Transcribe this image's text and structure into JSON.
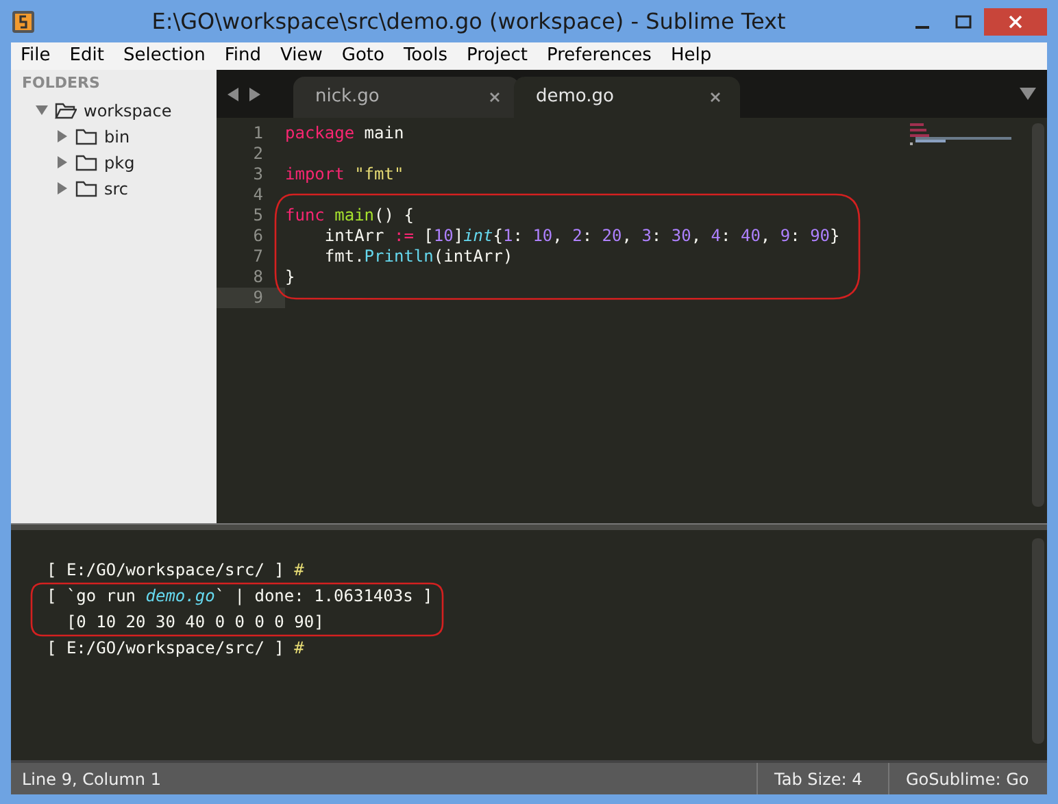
{
  "window": {
    "title": "E:\\GO\\workspace\\src\\demo.go (workspace) - Sublime Text"
  },
  "menu": [
    "File",
    "Edit",
    "Selection",
    "Find",
    "View",
    "Goto",
    "Tools",
    "Project",
    "Preferences",
    "Help"
  ],
  "sidebar": {
    "heading": "FOLDERS",
    "tree": [
      {
        "label": "workspace",
        "expanded": true,
        "children": [
          {
            "label": "bin",
            "expanded": false
          },
          {
            "label": "pkg",
            "expanded": false
          },
          {
            "label": "src",
            "expanded": false
          }
        ]
      }
    ]
  },
  "tabs": [
    {
      "label": "nick.go",
      "selected": false
    },
    {
      "label": "demo.go",
      "selected": true
    }
  ],
  "code_lines": [
    {
      "number": "1",
      "current": false,
      "tokens": [
        {
          "kind": "keyword",
          "text": "package"
        },
        {
          "kind": "plain",
          "text": " main"
        }
      ]
    },
    {
      "number": "2",
      "current": false
    },
    {
      "number": "3",
      "current": false,
      "tokens": [
        {
          "kind": "keyword",
          "text": "import "
        },
        {
          "kind": "string",
          "text": "\"fmt\""
        }
      ]
    },
    {
      "number": "4",
      "current": false
    },
    {
      "number": "5",
      "current": false,
      "tokens": [
        {
          "kind": "keyword",
          "text": "func "
        },
        {
          "kind": "function",
          "text": "main"
        },
        {
          "kind": "plain",
          "text": "() {"
        }
      ]
    },
    {
      "number": "6",
      "current": false,
      "tokens": [
        {
          "kind": "plain",
          "text": "    intArr "
        },
        {
          "kind": "keyword",
          "text": ":="
        },
        {
          "kind": "plain",
          "text": " ["
        },
        {
          "kind": "number",
          "text": "10"
        },
        {
          "kind": "plain",
          "text": "]"
        },
        {
          "kind": "type",
          "text": "int"
        },
        {
          "kind": "plain",
          "text": "{"
        },
        {
          "kind": "number",
          "text": "1"
        },
        {
          "kind": "plain",
          "text": ": "
        },
        {
          "kind": "number",
          "text": "10"
        },
        {
          "kind": "plain",
          "text": ", "
        },
        {
          "kind": "number",
          "text": "2"
        },
        {
          "kind": "plain",
          "text": ": "
        },
        {
          "kind": "number",
          "text": "20"
        },
        {
          "kind": "plain",
          "text": ", "
        },
        {
          "kind": "number",
          "text": "3"
        },
        {
          "kind": "plain",
          "text": ": "
        },
        {
          "kind": "number",
          "text": "30"
        },
        {
          "kind": "plain",
          "text": ", "
        },
        {
          "kind": "number",
          "text": "4"
        },
        {
          "kind": "plain",
          "text": ": "
        },
        {
          "kind": "number",
          "text": "40"
        },
        {
          "kind": "plain",
          "text": ", "
        },
        {
          "kind": "number",
          "text": "9"
        },
        {
          "kind": "plain",
          "text": ": "
        },
        {
          "kind": "number",
          "text": "90"
        },
        {
          "kind": "plain",
          "text": "}"
        }
      ]
    },
    {
      "number": "7",
      "current": false,
      "tokens": [
        {
          "kind": "plain",
          "text": "    fmt."
        },
        {
          "kind": "support",
          "text": "Println"
        },
        {
          "kind": "plain",
          "text": "(intArr)"
        }
      ]
    },
    {
      "number": "8",
      "current": false,
      "tokens": [
        {
          "kind": "plain",
          "text": "}"
        }
      ]
    },
    {
      "number": "9",
      "current": true
    }
  ],
  "console_lines": [
    {
      "tokens": [
        {
          "kind": "plain",
          "text": "[ E:/GO/workspace/src/ ] "
        },
        {
          "kind": "prompt",
          "text": "#"
        }
      ]
    },
    {
      "tokens": [
        {
          "kind": "plain",
          "text": "[ `go run "
        },
        {
          "kind": "file",
          "text": "demo.go"
        },
        {
          "kind": "plain",
          "text": "` | done: 1.0631403s ]"
        }
      ]
    },
    {
      "tokens": [
        {
          "kind": "plain",
          "text": "  [0 10 20 30 40 0 0 0 0 90]"
        }
      ]
    },
    {
      "tokens": [
        {
          "kind": "plain",
          "text": "[ E:/GO/workspace/src/ ] "
        },
        {
          "kind": "prompt",
          "text": "#"
        }
      ]
    }
  ],
  "status_bar": {
    "position": "Line 9, Column 1",
    "tab_size": "Tab Size: 4",
    "syntax": "GoSublime: Go"
  }
}
